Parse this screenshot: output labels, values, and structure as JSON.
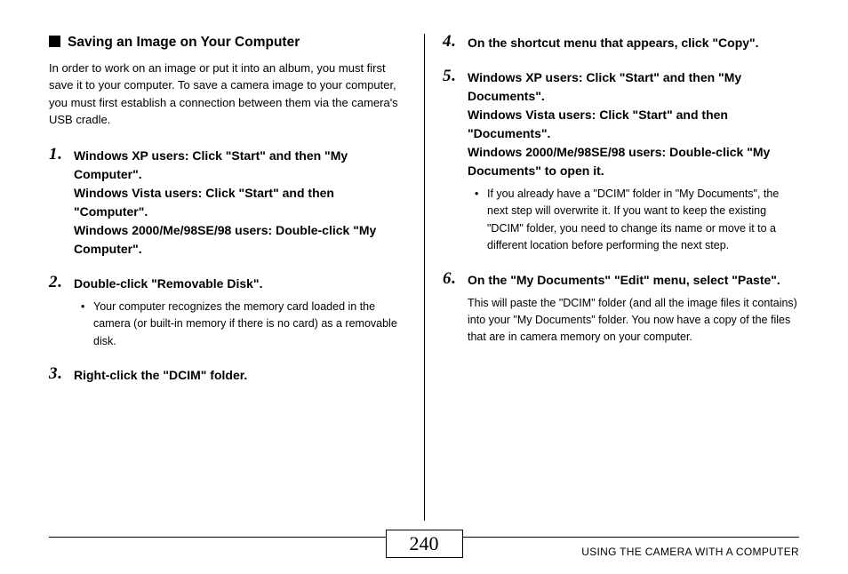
{
  "heading": "Saving an Image on Your Computer",
  "intro": "In order to work on an image or put it into an album, you must first save it to your computer. To save a camera image to your computer, you must first establish a connection between them via the camera's USB cradle.",
  "step1": {
    "num": "1",
    "line1": "Windows XP users: Click \"Start\" and then \"My Computer\".",
    "line2": "Windows Vista users: Click \"Start\" and then \"Computer\".",
    "line3": "Windows 2000/Me/98SE/98 users: Double-click \"My Computer\"."
  },
  "step2": {
    "num": "2",
    "title": "Double-click \"Removable Disk\".",
    "bullet": "Your computer recognizes the memory card loaded in the camera (or built-in memory if there is no card) as a removable disk."
  },
  "step3": {
    "num": "3",
    "title": "Right-click the \"DCIM\" folder."
  },
  "step4": {
    "num": "4",
    "title": "On the shortcut menu that appears, click \"Copy\"."
  },
  "step5": {
    "num": "5",
    "line1": "Windows XP users: Click \"Start\" and then \"My Documents\".",
    "line2": "Windows Vista users: Click \"Start\" and then \"Documents\".",
    "line3": "Windows 2000/Me/98SE/98 users: Double-click \"My Documents\" to open it.",
    "bullet": "If you already have a \"DCIM\" folder in \"My Documents\", the next step will overwrite it. If you want to keep the existing \"DCIM\" folder, you need to change its name or move it to a different location before performing the next step."
  },
  "step6": {
    "num": "6",
    "title": "On the \"My Documents\" \"Edit\" menu, select \"Paste\".",
    "body": "This will paste the \"DCIM\" folder (and all the image files it contains) into your \"My Documents\" folder. You now have a copy of the files that are in camera memory on your computer."
  },
  "pageNumber": "240",
  "footerText": "USING THE CAMERA WITH A COMPUTER"
}
